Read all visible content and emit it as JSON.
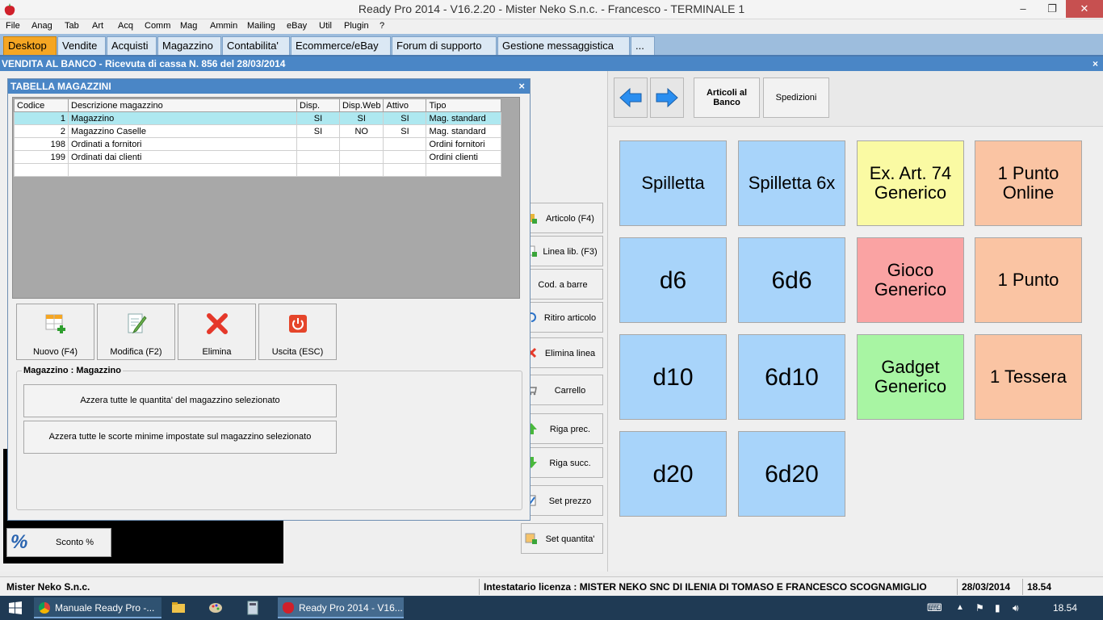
{
  "window": {
    "title": "Ready Pro 2014 - V16.2.20 - Mister Neko S.n.c. - Francesco - TERMINALE 1",
    "minimize": "–",
    "restore": "❐",
    "close": "✕"
  },
  "menu": [
    "File",
    "Anag",
    "Tab",
    "Art",
    "Acq",
    "Comm",
    "Mag",
    "Ammin",
    "Mailing",
    "eBay",
    "Util",
    "Plugin",
    "?"
  ],
  "tabs": [
    "Desktop",
    "Vendite",
    "Acquisti",
    "Magazzino",
    "Contabilita'",
    "Ecommerce/eBay",
    "Forum di supporto",
    "Gestione messaggistica",
    "..."
  ],
  "banner": {
    "text": "VENDITA AL BANCO - Ricevuta di cassa N. 856 del 28/03/2014",
    "close": "×"
  },
  "dialog": {
    "title": "TABELLA MAGAZZINI",
    "close": "×",
    "columns": [
      "Codice",
      "Descrizione magazzino",
      "Disp.",
      "Disp.Web",
      "Attivo",
      "Tipo"
    ],
    "rows": [
      {
        "code": "1",
        "desc": "Magazzino",
        "disp": "SI",
        "web": "SI",
        "att": "SI",
        "tipo": "Mag. standard"
      },
      {
        "code": "2",
        "desc": "Magazzino Caselle",
        "disp": "SI",
        "web": "NO",
        "att": "SI",
        "tipo": "Mag. standard"
      },
      {
        "code": "198",
        "desc": "Ordinati a fornitori",
        "disp": "",
        "web": "",
        "att": "",
        "tipo": "Ordini fornitori"
      },
      {
        "code": "199",
        "desc": "Ordinati dai clienti",
        "disp": "",
        "web": "",
        "att": "",
        "tipo": "Ordini clienti"
      }
    ],
    "buttons": {
      "nuovo": "Nuovo (F4)",
      "modifica": "Modifica (F2)",
      "elimina": "Elimina",
      "uscita": "Uscita (ESC)"
    },
    "group_title": "Magazzino : Magazzino",
    "azzera_qta": "Azzera tutte le quantita' del magazzino selezionato",
    "azzera_scorte": "Azzera tutte le scorte minime impostate sul magazzino selezionato"
  },
  "sidebar_buttons": [
    {
      "label": "Articolo (F4)",
      "icon": "box-add-icon"
    },
    {
      "label": "Linea lib. (F3)",
      "icon": "grid-add-icon"
    },
    {
      "label": "Cod. a barre",
      "icon": "barcode-icon"
    },
    {
      "label": "Ritiro articolo",
      "icon": "undo-icon"
    },
    {
      "label": "Elimina linea",
      "icon": "delete-icon"
    },
    {
      "label": "Carrello",
      "icon": "cart-icon"
    },
    {
      "label": "Riga prec.",
      "icon": "arrow-up-icon"
    },
    {
      "label": "Riga succ.",
      "icon": "arrow-down-icon"
    },
    {
      "label": "Set prezzo",
      "icon": "price-icon"
    },
    {
      "label": "Set quantita'",
      "icon": "quantity-icon"
    }
  ],
  "sconto": {
    "icon_glyph": "%",
    "label": "Sconto %"
  },
  "right_panel": {
    "articoli_banco": "Articoli al Banco",
    "spedizioni": "Spedizioni"
  },
  "tiles": [
    {
      "label": "Spilletta",
      "color": "#a8d4fa",
      "size": 22
    },
    {
      "label": "Spilletta 6x",
      "color": "#a8d4fa",
      "size": 22
    },
    {
      "label": "Ex. Art. 74\nGenerico",
      "color": "#fafaa3",
      "size": 22
    },
    {
      "label": "1 Punto\nOnline",
      "color": "#fac4a3",
      "size": 22
    },
    {
      "label": "d6",
      "color": "#a8d4fa",
      "size": 30
    },
    {
      "label": "6d6",
      "color": "#a8d4fa",
      "size": 30
    },
    {
      "label": "Gioco\nGenerico",
      "color": "#faa3a3",
      "size": 22
    },
    {
      "label": "1 Punto",
      "color": "#fac4a3",
      "size": 22
    },
    {
      "label": "d10",
      "color": "#a8d4fa",
      "size": 30
    },
    {
      "label": "6d10",
      "color": "#a8d4fa",
      "size": 30
    },
    {
      "label": "Gadget\nGenerico",
      "color": "#a8f5a3",
      "size": 22
    },
    {
      "label": "1 Tessera",
      "color": "#fac4a3",
      "size": 22
    },
    {
      "label": "d20",
      "color": "#a8d4fa",
      "size": 30
    },
    {
      "label": "6d20",
      "color": "#a8d4fa",
      "size": 30
    }
  ],
  "status": {
    "company": "Mister Neko S.n.c.",
    "license": "Intestatario licenza : MISTER NEKO SNC DI ILENIA DI TOMASO E FRANCESCO SCOGNAMIGLIO",
    "date": "28/03/2014",
    "time": "18.54"
  },
  "taskbar": {
    "start_icon": "windows-icon",
    "apps": [
      {
        "label": "Manuale Ready Pro -...",
        "icon": "chrome-icon"
      },
      {
        "label": "Ready Pro 2014 - V16...",
        "icon": "strawberry-icon"
      }
    ],
    "clock": "18.54"
  }
}
